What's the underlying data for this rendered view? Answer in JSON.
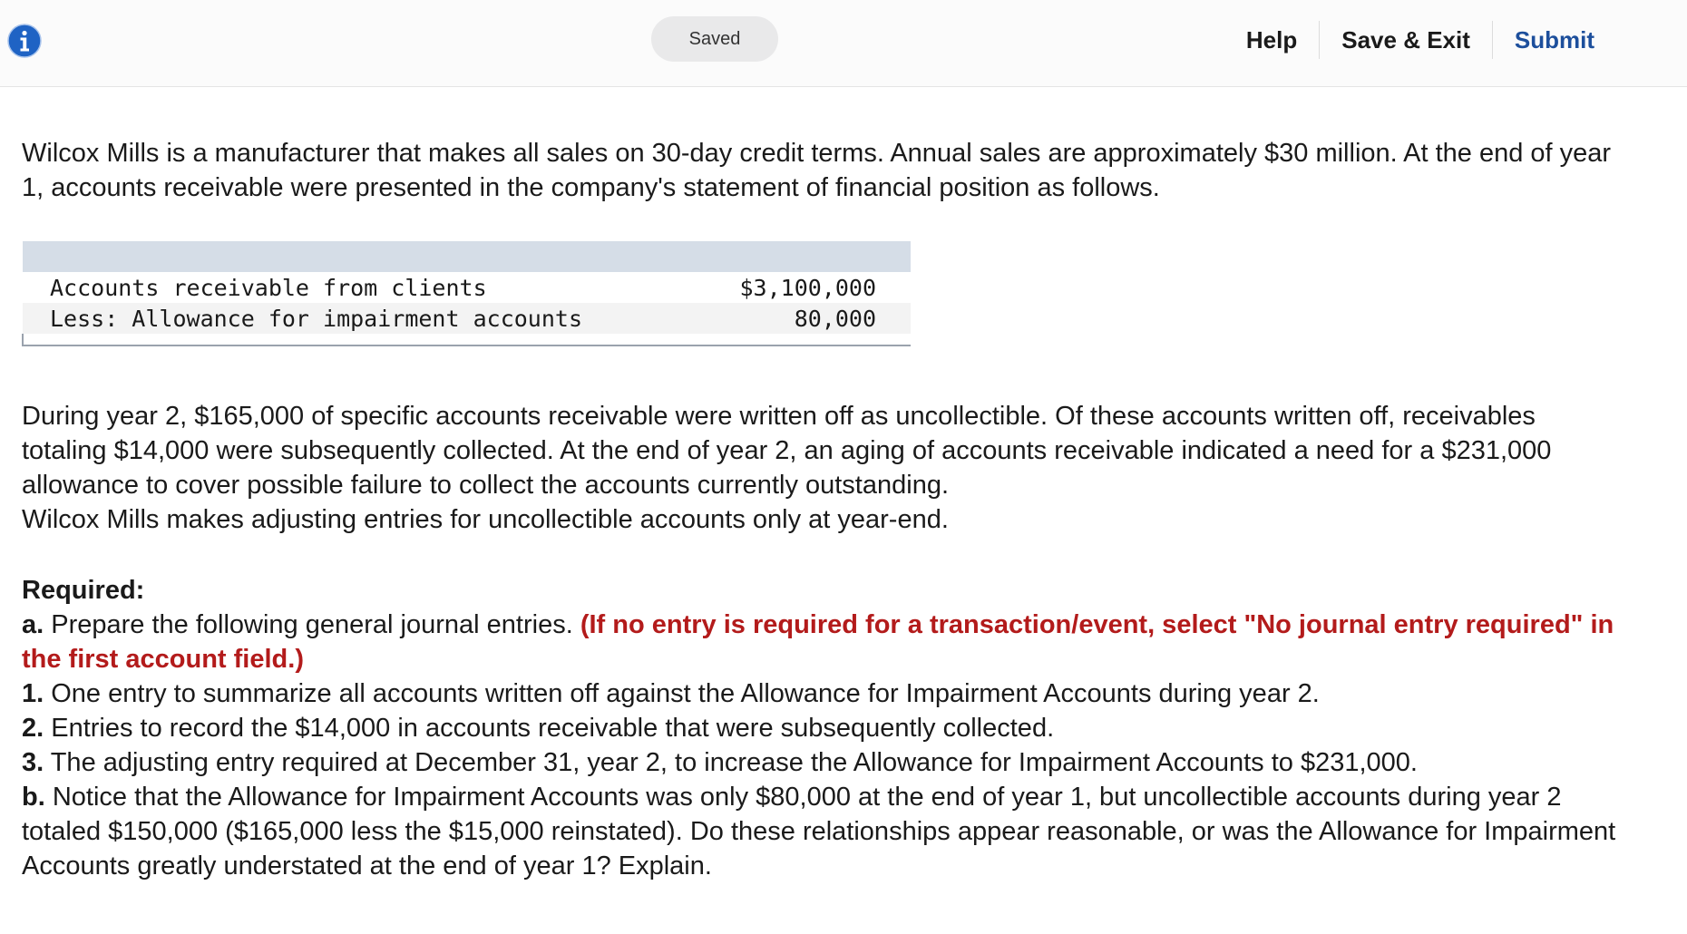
{
  "topbar": {
    "status_label": "Saved",
    "help_label": "Help",
    "save_exit_label": "Save & Exit",
    "submit_label": "Submit",
    "info_icon": "info-icon",
    "submit_color": "#1d4f9c"
  },
  "intro_text": "Wilcox Mills is a manufacturer that makes all sales on 30-day credit terms. Annual sales are approximately $30 million. At the end of year 1, accounts receivable were presented in the company's statement of financial position as follows.",
  "ar_table": {
    "rows": [
      {
        "label": "Accounts receivable from clients",
        "value": "$3,100,000"
      },
      {
        "label": "Less: Allowance for impairment accounts",
        "value": "80,000"
      }
    ]
  },
  "year2_text": "During year 2, $165,000 of specific accounts receivable were written off as uncollectible. Of these accounts written off, receivables totaling $14,000 were subsequently collected. At the end of year 2, an aging of accounts receivable indicated a need for a $231,000 allowance to cover possible failure to collect the accounts currently outstanding.",
  "adjusting_text": "Wilcox Mills makes adjusting entries for uncollectible accounts only at year-end.",
  "required": {
    "heading": "Required:",
    "a_label": "a.",
    "a_text": " Prepare the following general journal entries. ",
    "a_note": "(If no entry is required for a transaction/event, select \"No journal entry required\" in the first account field.)",
    "items": [
      {
        "num": "1.",
        "text": " One entry to summarize all accounts written off against the Allowance for Impairment Accounts during year 2."
      },
      {
        "num": "2.",
        "text": " Entries to record the $14,000 in accounts receivable that were subsequently collected."
      },
      {
        "num": "3.",
        "text": " The adjusting entry required at December 31, year 2, to increase the Allowance for Impairment Accounts to $231,000."
      }
    ],
    "b_label": "b.",
    "b_text": " Notice that the Allowance for Impairment Accounts was only $80,000 at the end of year 1, but uncollectible accounts during year 2 totaled $150,000 ($165,000 less the $15,000 reinstated). Do these relationships appear reasonable, or was the Allowance for Impairment Accounts greatly understated at the end of year 1? Explain.",
    "note_color": "#b31b1b"
  }
}
